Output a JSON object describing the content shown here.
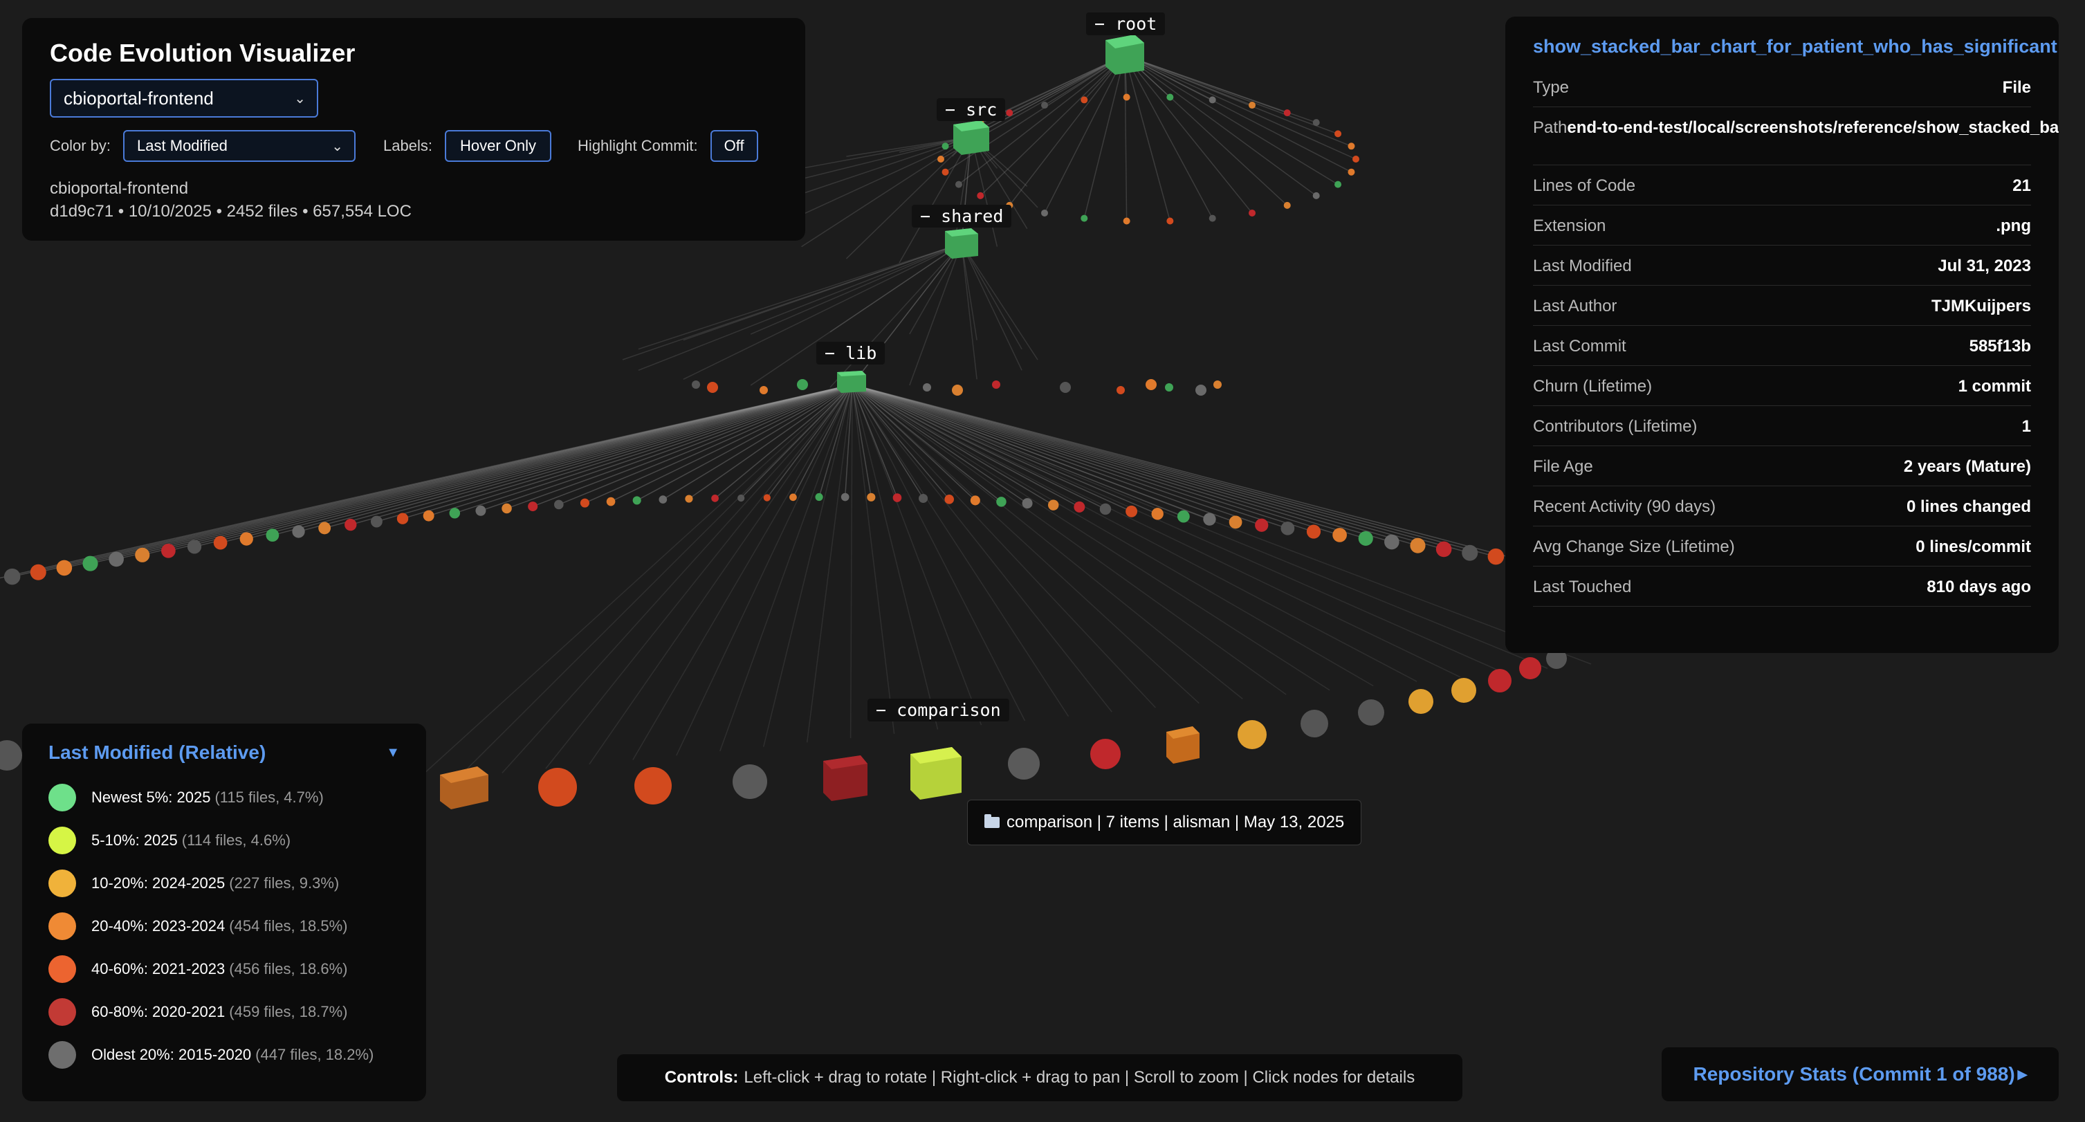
{
  "app": {
    "title": "Code Evolution Visualizer",
    "repo_select_value": "cbioportal-frontend",
    "color_by_label": "Color by:",
    "color_by_value": "Last Modified",
    "labels_label": "Labels:",
    "labels_value": "Hover Only",
    "highlight_label": "Highlight Commit:",
    "highlight_value": "Off",
    "repo_name": "cbioportal-frontend",
    "repo_meta": "d1d9c71 • 10/10/2025 • 2452 files • 657,554 LOC"
  },
  "scene_labels": {
    "root": "− root",
    "src": "− src",
    "shared": "− shared",
    "lib": "− lib",
    "comparison": "− comparison"
  },
  "info": {
    "file_name": "show_stacked_bar_chart_for_patient_who_has_significant",
    "rows": [
      {
        "key": "Type",
        "value": "File"
      },
      {
        "key": "Path",
        "value": "end-to-end-test/local/screenshots/reference/show_stacked_bar_chart_for_p"
      },
      {
        "key": "Lines of Code",
        "value": "21"
      },
      {
        "key": "Extension",
        "value": ".png"
      },
      {
        "key": "Last Modified",
        "value": "Jul 31, 2023"
      },
      {
        "key": "Last Author",
        "value": "TJMKuijpers"
      },
      {
        "key": "Last Commit",
        "value": "585f13b"
      },
      {
        "key": "Churn (Lifetime)",
        "value": "1 commit"
      },
      {
        "key": "Contributors (Lifetime)",
        "value": "1"
      },
      {
        "key": "File Age",
        "value": "2 years (Mature)"
      },
      {
        "key": "Recent Activity (90 days)",
        "value": "0 lines changed"
      },
      {
        "key": "Avg Change Size (Lifetime)",
        "value": "0 lines/commit"
      },
      {
        "key": "Last Touched",
        "value": "810 days ago"
      }
    ]
  },
  "legend": {
    "title": "Last Modified (Relative)",
    "toggle_icon": "triangle-down-icon",
    "items": [
      {
        "label": "Newest 5%: 2025",
        "detail": "(115 files, 4.7%)",
        "color": "#6ee08a"
      },
      {
        "label": "5-10%: 2025",
        "detail": "(114 files, 4.6%)",
        "color": "#d6f545"
      },
      {
        "label": "10-20%: 2024-2025",
        "detail": "(227 files, 9.3%)",
        "color": "#f0b23a"
      },
      {
        "label": "20-40%: 2023-2024",
        "detail": "(454 files, 18.5%)",
        "color": "#ef8a35"
      },
      {
        "label": "40-60%: 2021-2023",
        "detail": "(456 files, 18.6%)",
        "color": "#ec6430"
      },
      {
        "label": "60-80%: 2020-2021",
        "detail": "(459 files, 18.7%)",
        "color": "#c23a35"
      },
      {
        "label": "Oldest 20%: 2015-2020",
        "detail": "(447 files, 18.2%)",
        "color": "#6e6e6e"
      }
    ]
  },
  "tooltip": {
    "icon": "folder-icon",
    "text": "comparison | 7 items | alisman | May 13, 2025"
  },
  "controls": {
    "label": "Controls:",
    "text": "Left-click + drag to rotate | Right-click + drag to pan | Scroll to zoom | Click nodes for details"
  },
  "stats": {
    "text": "Repository Stats (Commit 1 of 988)",
    "arrow_icon": "triangle-right-icon"
  },
  "colors": {
    "background": "#1c1c1c",
    "panel": "#0b0b0b",
    "accent": "#5d9bf0",
    "folder_node": "#4fc06a"
  }
}
